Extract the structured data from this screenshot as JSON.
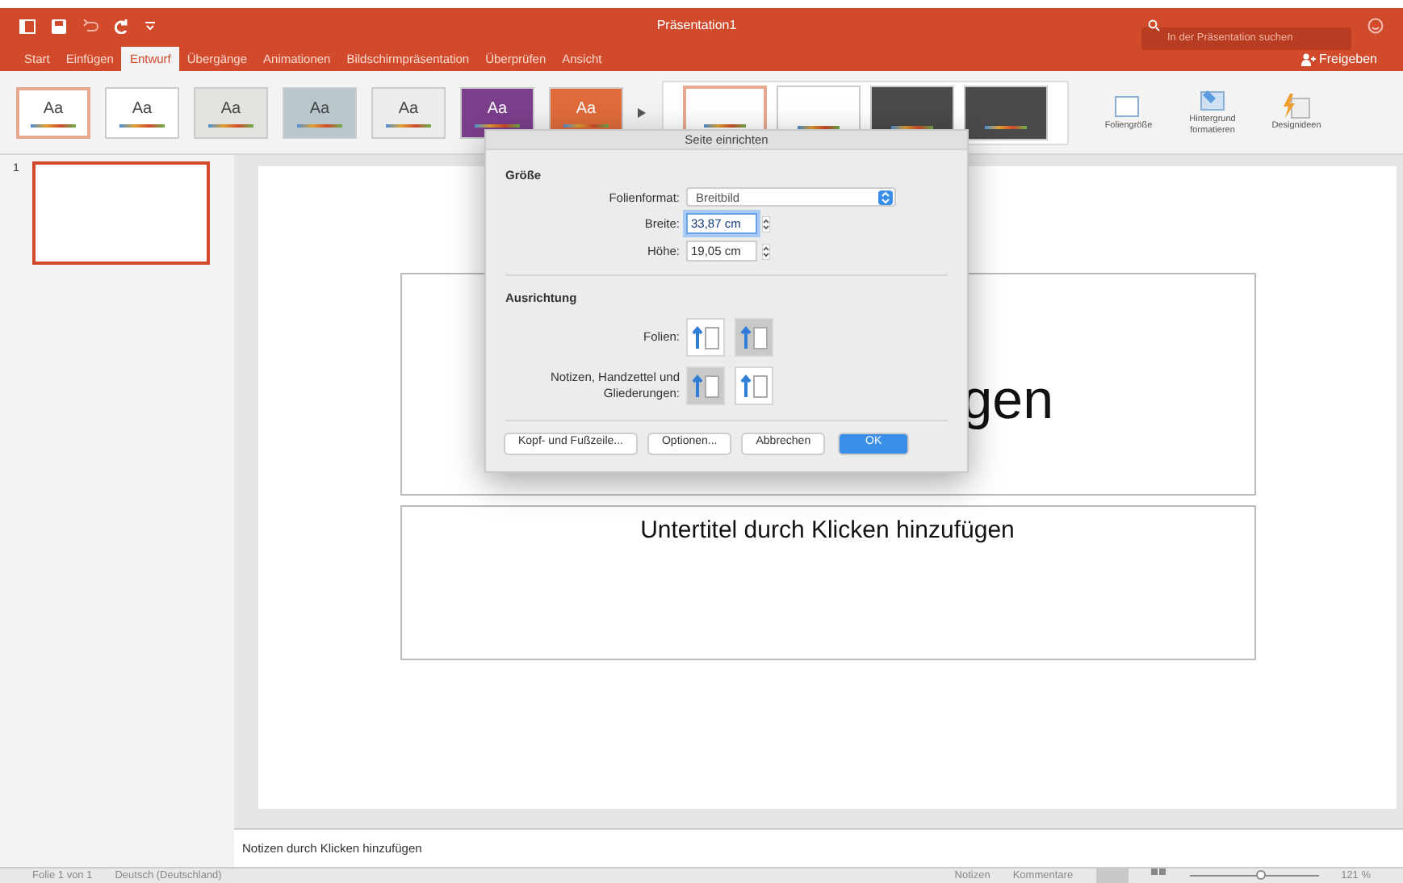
{
  "window": {
    "title": "Präsentation1"
  },
  "search": {
    "placeholder": "In der Präsentation suchen"
  },
  "tabs": [
    {
      "label": "Start",
      "selected": false
    },
    {
      "label": "Einfügen",
      "selected": false
    },
    {
      "label": "Entwurf",
      "selected": true
    },
    {
      "label": "Übergänge",
      "selected": false
    },
    {
      "label": "Animationen",
      "selected": false
    },
    {
      "label": "Bildschirmpräsentation",
      "selected": false
    },
    {
      "label": "Überprüfen",
      "selected": false
    },
    {
      "label": "Ansicht",
      "selected": false
    }
  ],
  "share": {
    "label": "Freigeben"
  },
  "themes": [
    {
      "label": "Aa",
      "color": "#ffffff",
      "selected": true
    },
    {
      "label": "Aa",
      "color": "#ffffff",
      "selected": false
    },
    {
      "label": "Aa",
      "color": "#e4e2de",
      "selected": false
    },
    {
      "label": "Aa",
      "color": "#b9c6cc",
      "selected": false
    },
    {
      "label": "Aa",
      "color": "#ececec",
      "selected": false
    },
    {
      "label": "Aa",
      "color": "#7b3f8c",
      "selected": false
    },
    {
      "label": "Aa",
      "color": "#e06b3c",
      "selected": false
    }
  ],
  "variants": [
    {
      "color": "#ffffff",
      "selected": true
    },
    {
      "color": "#ffffff",
      "selected": false
    },
    {
      "color": "#4a4a4a",
      "selected": false
    },
    {
      "color": "#4a4a4a",
      "selected": false
    }
  ],
  "ribbon_buttons": [
    {
      "label": "Foliengröße"
    },
    {
      "label": "Hintergrund formatieren"
    },
    {
      "label": "Designideen"
    }
  ],
  "thumbnails": [
    {
      "number": "1",
      "selected": true
    }
  ],
  "slide": {
    "title_fragment": "gen",
    "subtitle": "Untertitel durch Klicken hinzufügen"
  },
  "notes": {
    "placeholder": "Notizen durch Klicken hinzufügen"
  },
  "dialog": {
    "title": "Seite einrichten",
    "size_heading": "Größe",
    "format_label": "Folienformat:",
    "format_value": "Breitbild",
    "width_label": "Breite:",
    "width_value": "33,87 cm",
    "height_label": "Höhe:",
    "height_value": "19,05 cm",
    "orientation_heading": "Ausrichtung",
    "orientation_rows": [
      {
        "label": "Folien:",
        "options": [
          {
            "selected": false
          },
          {
            "selected": true
          }
        ]
      },
      {
        "label": "Notizen, Handzettel und Gliederungen:",
        "options": [
          {
            "selected": true
          },
          {
            "selected": false
          }
        ]
      }
    ],
    "buttons": [
      {
        "label": "Kopf- und Fußzeile...",
        "primary": false
      },
      {
        "label": "Optionen...",
        "primary": false
      },
      {
        "label": "Abbrechen",
        "primary": false
      },
      {
        "label": "OK",
        "primary": true
      }
    ]
  },
  "status_bar": {
    "slide_info": "Folie 1 von 1",
    "language": "Deutsch (Deutschland)",
    "notes": "Notizen",
    "comments": "Kommentare",
    "zoom": "121 %",
    "zoom_slider": {
      "level": 0.55
    }
  }
}
